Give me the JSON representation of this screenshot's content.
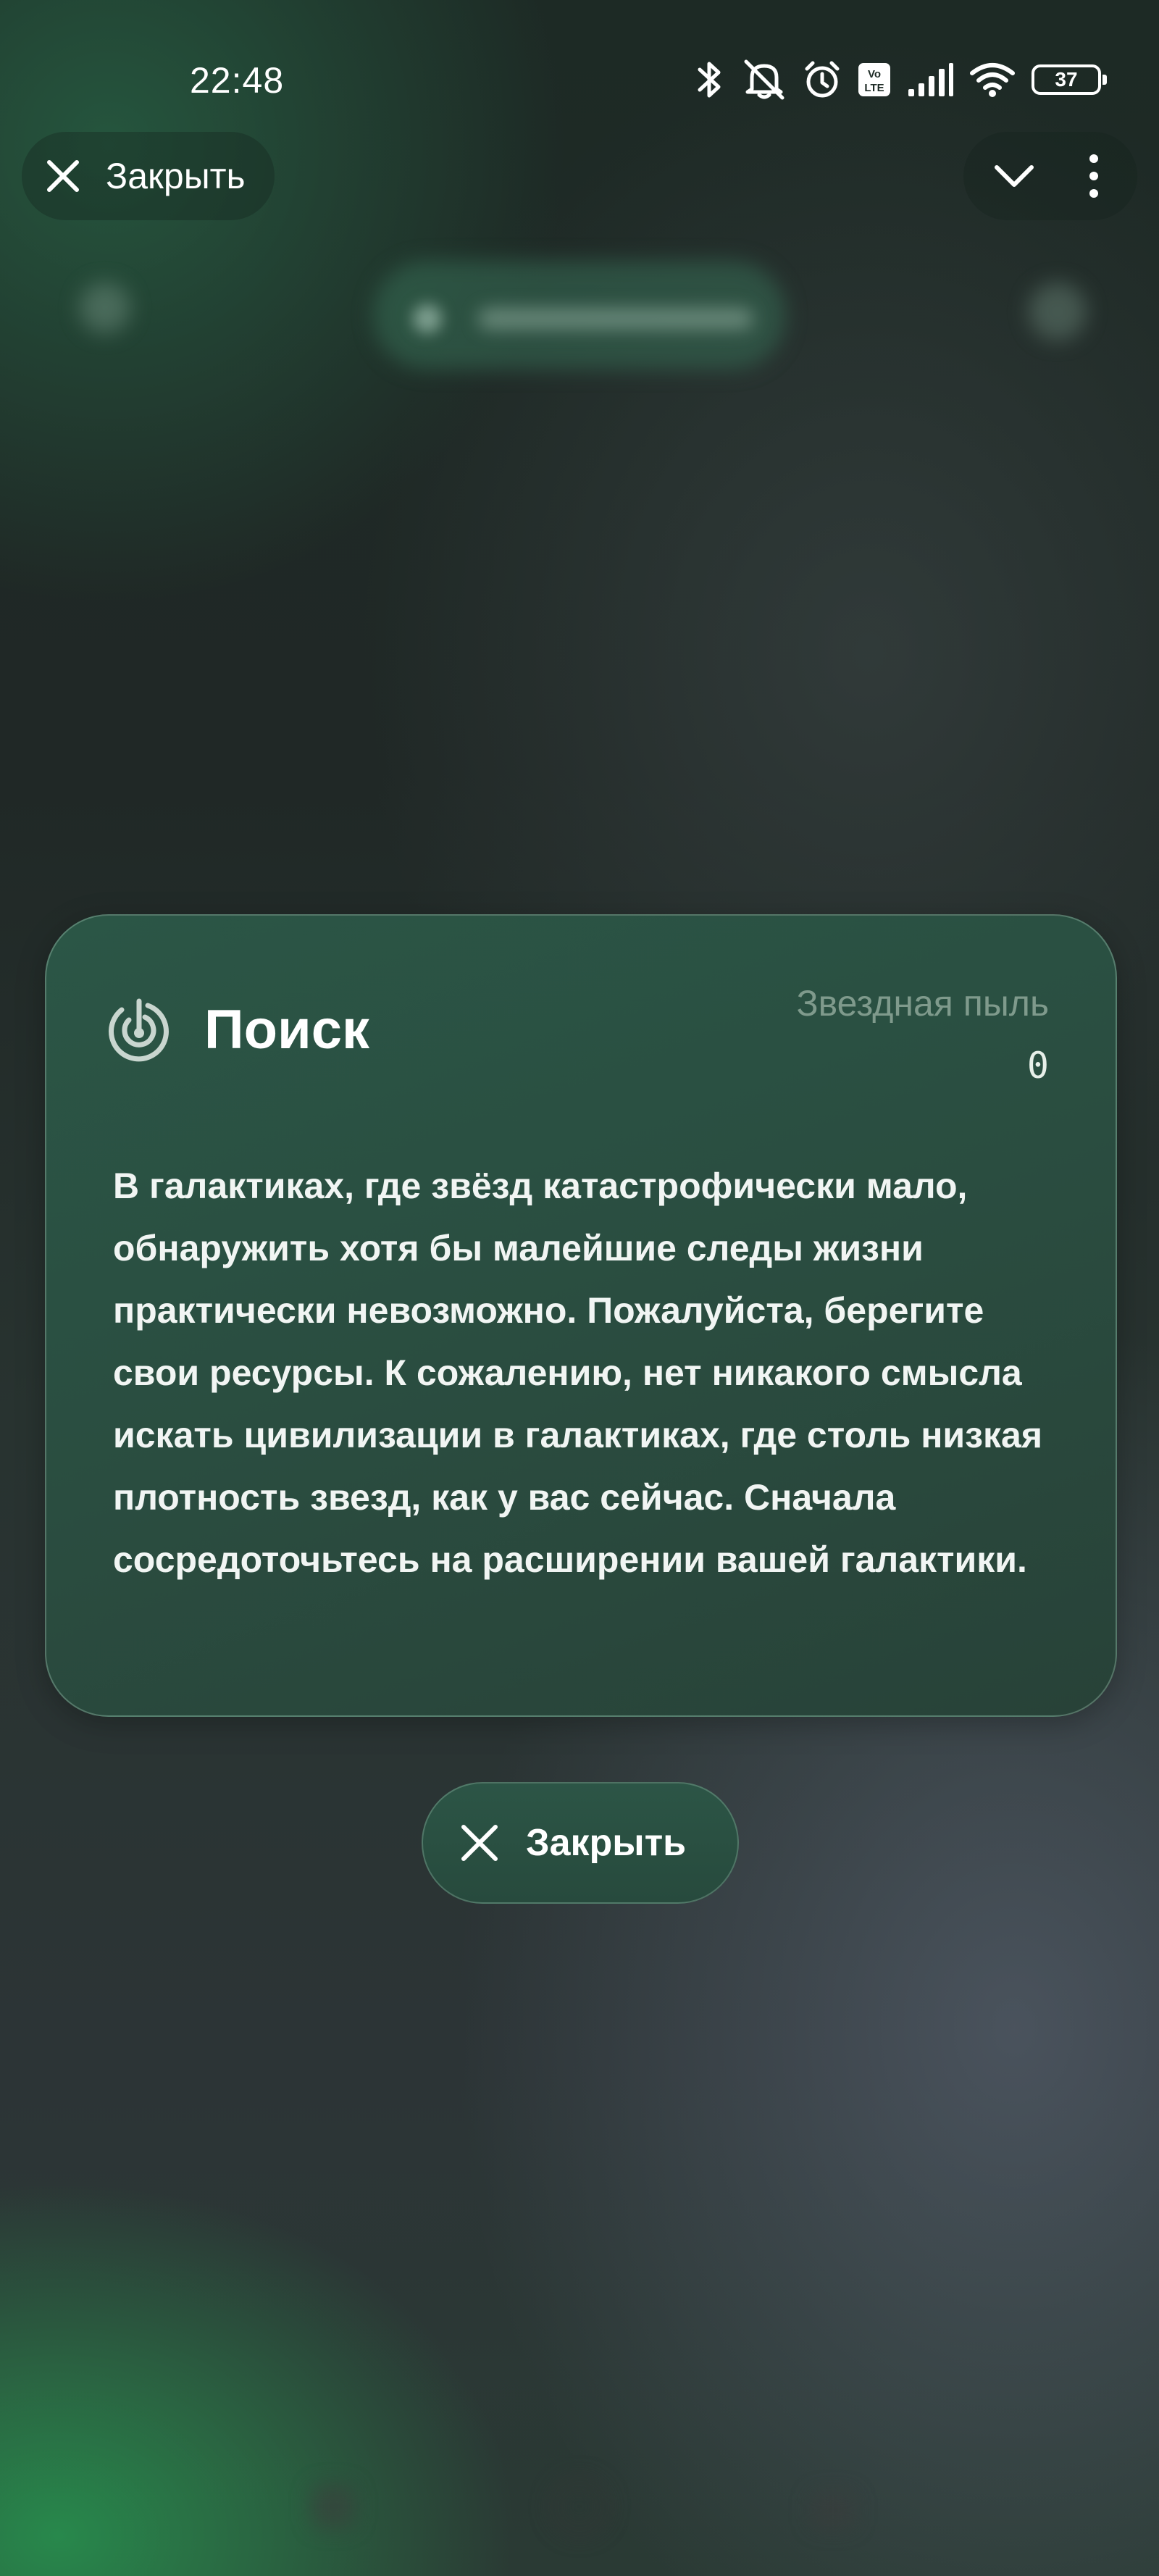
{
  "status_bar": {
    "time": "22:48",
    "icons": [
      "bluetooth-icon",
      "bell-off-icon",
      "alarm-icon",
      "volte-icon",
      "signal-icon",
      "wifi-icon",
      "battery-icon"
    ],
    "volte_text": "Vo LTE",
    "battery_level": "37"
  },
  "top_bar": {
    "close_label": "Закрыть"
  },
  "dialog": {
    "title": "Поиск",
    "stardust_label": "Звездная пыль",
    "stardust_value": "0",
    "message": "В галактиках, где звёзд катастрофически мало, обнаружить хотя бы малейшие следы жизни практически невозможно. Пожалуйста, берегите свои ресурсы. К сожалению, нет никакого смысла искать цивилизации в галактиках, где столь низкая плотность звезд, как у вас сейчас. Сначала сосредоточьтесь на расширении вашей галактики.",
    "close_label": "Закрыть"
  },
  "colors": {
    "card_background": "#2a4d40",
    "muted_text": "#7f9a8c",
    "text": "#ffffff"
  }
}
